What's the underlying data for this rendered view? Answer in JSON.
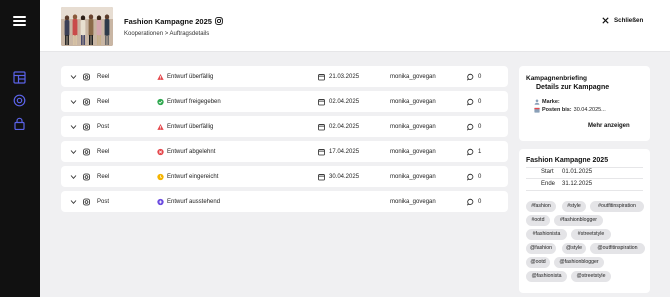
{
  "header": {
    "title": "Fashion Kampagne 2025",
    "breadcrumb": "Kooperationen > Auftragsdetails",
    "close_label": "Schließen"
  },
  "rows": [
    {
      "type": "Reel",
      "status": "Entwurf überfällig",
      "status_icon": "warning-icon",
      "status_color": "#e5484d",
      "date": "21.03.2025",
      "user": "monika_govegan",
      "comments": "0"
    },
    {
      "type": "Reel",
      "status": "Entwurf freigegeben",
      "status_icon": "check-circle-icon",
      "status_color": "#2fa84f",
      "date": "02.04.2025",
      "user": "monika_govegan",
      "comments": "0"
    },
    {
      "type": "Post",
      "status": "Entwurf überfällig",
      "status_icon": "warning-icon",
      "status_color": "#e5484d",
      "date": "02.04.2025",
      "user": "monika_govegan",
      "comments": "0"
    },
    {
      "type": "Reel",
      "status": "Entwurf abgelehnt",
      "status_icon": "x-circle-icon",
      "status_color": "#e5484d",
      "date": "17.04.2025",
      "user": "monika_govegan",
      "comments": "1"
    },
    {
      "type": "Reel",
      "status": "Entwurf eingereicht",
      "status_icon": "clock-circle-icon",
      "status_color": "#f5b400",
      "date": "30.04.2025",
      "user": "monika_govegan",
      "comments": "0"
    },
    {
      "type": "Post",
      "status": "Entwurf ausstehend",
      "status_icon": "plus-circle-icon",
      "status_color": "#6c4ce0",
      "date": "",
      "user": "monika_govegan",
      "comments": "0"
    }
  ],
  "briefing": {
    "heading": "Kampagnenbriefing",
    "subheading": "Details zur Kampagne",
    "brand_label": "Marke:",
    "brand_value": "",
    "post_label": "Posten bis:",
    "post_value": "30.04.2025...",
    "more_label": "Mehr anzeigen"
  },
  "campaign": {
    "title": "Fashion Kampagne 2025",
    "start_label": "Start",
    "start_value": "01.01.2025",
    "end_label": "Ende",
    "end_value": "31.12.2025",
    "tags": [
      "#fashion",
      "#style",
      "#outfitinspiration",
      "#ootd",
      "#fashionblogger",
      "#fashionista",
      "#streetstyle",
      "@fashion",
      "@style",
      "@outfitinspiration",
      "@ootd",
      "@fashionblogger",
      "@fashionista",
      "@streetstyle"
    ]
  },
  "colors": {
    "sidebar": "#111111",
    "accent_warning": "#e5484d",
    "accent_success": "#2fa84f",
    "accent_pending": "#f5b400",
    "accent_waiting": "#6c4ce0"
  }
}
